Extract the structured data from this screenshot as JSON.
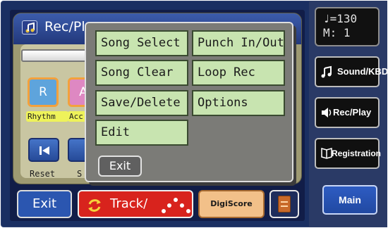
{
  "rec_window": {
    "title": "Rec/Pl",
    "parts": [
      {
        "letter": "R",
        "label": "Rhythm"
      },
      {
        "letter": "A",
        "label": "Acc"
      }
    ],
    "reset_label": "Reset",
    "stop_label": "S"
  },
  "menu": {
    "items": [
      {
        "label": "Song Select"
      },
      {
        "label": "Punch In/Out"
      },
      {
        "label": "Song Clear"
      },
      {
        "label": "Loop Rec"
      },
      {
        "label": "Save/Delete"
      },
      {
        "label": "Options"
      },
      {
        "label": "Edit"
      }
    ],
    "exit_label": "Exit"
  },
  "bottom_bar": {
    "exit_label": "Exit",
    "track_label": "Track/",
    "digiscore_label": "DigiScore"
  },
  "sidebar": {
    "tempo_line": "♩=130",
    "measure_line": "M:  1",
    "sound_kbd_label": "Sound/KBD",
    "rec_play_label": "Rec/Play",
    "registration_label": "Registration",
    "main_label": "Main"
  },
  "colors": {
    "frame": "#1a2f62",
    "menu_item": "#c8e4b0",
    "track_button": "#d8231d",
    "main_button": "#2e5cc2"
  }
}
